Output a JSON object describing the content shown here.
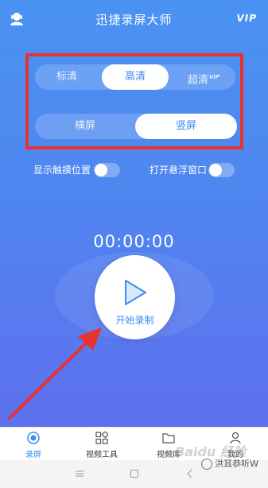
{
  "app": {
    "title": "迅捷录屏大师",
    "vip_label": "VIP"
  },
  "quality": {
    "options": [
      "标清",
      "高清",
      "超清"
    ],
    "selected": "高清",
    "vip_badge": "VIP"
  },
  "orientation": {
    "options": [
      "横屏",
      "竖屏"
    ],
    "selected": "竖屏"
  },
  "toggles": [
    {
      "label": "显示触摸位置",
      "on": false
    },
    {
      "label": "打开悬浮窗口",
      "on": false
    }
  ],
  "timer": "00:00:00",
  "record_button": {
    "label": "开始录制"
  },
  "tabs": [
    {
      "label": "录屏",
      "icon": "record-icon",
      "active": true
    },
    {
      "label": "视频工具",
      "icon": "grid-icon",
      "active": false
    },
    {
      "label": "视频库",
      "icon": "folder-icon",
      "active": false
    },
    {
      "label": "我的",
      "icon": "person-icon",
      "active": false
    }
  ],
  "watermark": {
    "text": "洪耳恭听W",
    "baidu": "Baidu 经验"
  },
  "colors": {
    "accent": "#3a8ef3",
    "annotation": "#e8322f"
  }
}
